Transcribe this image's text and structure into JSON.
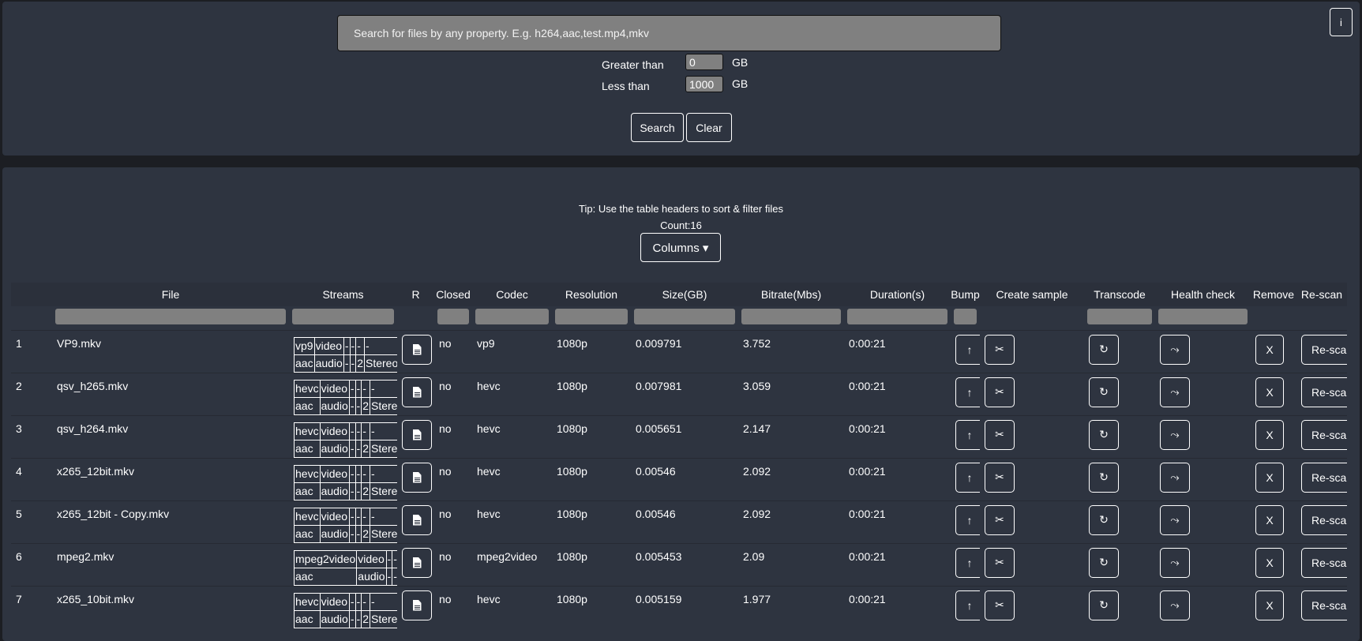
{
  "search": {
    "placeholder": "Search for files by any property. E.g. h264,aac,test.mp4,mkv",
    "greater_label": "Greater than",
    "greater_value": "0",
    "less_label": "Less than",
    "less_value": "1000",
    "unit": "GB",
    "search_label": "Search",
    "clear_label": "Clear",
    "info_label": "i"
  },
  "main": {
    "tip": "Tip: Use the table headers to sort & filter files",
    "count": "Count:16",
    "columns_label": "Columns ▾"
  },
  "table": {
    "headers": [
      "",
      "File",
      "Streams",
      "R",
      "Closed",
      "Codec",
      "Resolution",
      "Size(GB)",
      "Bitrate(Mbs)",
      "Duration(s)",
      "Bump",
      "Create sample",
      "Transcode",
      "Health check",
      "Remove",
      "Re-scan"
    ],
    "filters": [
      false,
      true,
      true,
      false,
      true,
      true,
      true,
      true,
      true,
      true,
      true,
      false,
      true,
      true,
      false,
      false
    ],
    "icons": {
      "r": "document-icon",
      "bump": "arrow-up-icon",
      "sample": "scissors-icon",
      "transcode": "refresh-icon",
      "health": "wave-arrow-icon",
      "remove": "x-icon"
    },
    "button_text": {
      "bump": "↑",
      "sample": "✂",
      "transcode": "↻",
      "health": "⤳",
      "remove": "X",
      "rescan": "Re-scan"
    },
    "rows": [
      {
        "n": "1",
        "file": "VP9.mkv",
        "streams": [
          [
            "vp9",
            "video",
            "-",
            "-",
            "-",
            "-"
          ],
          [
            "aac",
            "audio",
            "-",
            "-",
            "2",
            "Stereo"
          ]
        ],
        "closed": "no",
        "codec": "vp9",
        "resolution": "1080p",
        "size": "0.009791",
        "bitrate": "3.752",
        "duration": "0:00:21"
      },
      {
        "n": "2",
        "file": "qsv_h265.mkv",
        "streams": [
          [
            "hevc",
            "video",
            "-",
            "-",
            "-",
            "-"
          ],
          [
            "aac",
            "audio",
            "-",
            "-",
            "2",
            "Stereo"
          ]
        ],
        "closed": "no",
        "codec": "hevc",
        "resolution": "1080p",
        "size": "0.007981",
        "bitrate": "3.059",
        "duration": "0:00:21"
      },
      {
        "n": "3",
        "file": "qsv_h264.mkv",
        "streams": [
          [
            "hevc",
            "video",
            "-",
            "-",
            "-",
            "-"
          ],
          [
            "aac",
            "audio",
            "-",
            "-",
            "2",
            "Stereo"
          ]
        ],
        "closed": "no",
        "codec": "hevc",
        "resolution": "1080p",
        "size": "0.005651",
        "bitrate": "2.147",
        "duration": "0:00:21"
      },
      {
        "n": "4",
        "file": "x265_12bit.mkv",
        "streams": [
          [
            "hevc",
            "video",
            "-",
            "-",
            "-",
            "-"
          ],
          [
            "aac",
            "audio",
            "-",
            "-",
            "2",
            "Stereo"
          ]
        ],
        "closed": "no",
        "codec": "hevc",
        "resolution": "1080p",
        "size": "0.00546",
        "bitrate": "2.092",
        "duration": "0:00:21"
      },
      {
        "n": "5",
        "file": "x265_12bit - Copy.mkv",
        "streams": [
          [
            "hevc",
            "video",
            "-",
            "-",
            "-",
            "-"
          ],
          [
            "aac",
            "audio",
            "-",
            "-",
            "2",
            "Stereo"
          ]
        ],
        "closed": "no",
        "codec": "hevc",
        "resolution": "1080p",
        "size": "0.00546",
        "bitrate": "2.092",
        "duration": "0:00:21"
      },
      {
        "n": "6",
        "file": "mpeg2.mkv",
        "streams": [
          [
            "mpeg2video",
            "video",
            "-",
            "-"
          ],
          [
            "aac",
            "audio",
            "-",
            "-"
          ]
        ],
        "closed": "no",
        "codec": "mpeg2video",
        "resolution": "1080p",
        "size": "0.005453",
        "bitrate": "2.09",
        "duration": "0:00:21"
      },
      {
        "n": "7",
        "file": "x265_10bit.mkv",
        "streams": [
          [
            "hevc",
            "video",
            "-",
            "-",
            "-",
            "-"
          ],
          [
            "aac",
            "audio",
            "-",
            "-",
            "2",
            "Stereo"
          ]
        ],
        "closed": "no",
        "codec": "hevc",
        "resolution": "1080p",
        "size": "0.005159",
        "bitrate": "1.977",
        "duration": "0:00:21"
      }
    ]
  }
}
